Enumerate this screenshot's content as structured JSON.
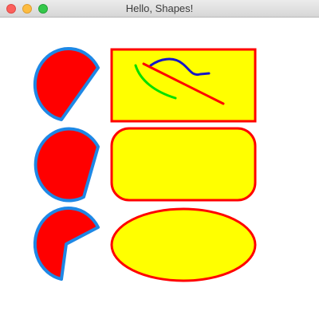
{
  "window": {
    "title": "Hello, Shapes!"
  },
  "colors": {
    "shape_fill": "#ff0000",
    "shape_outline": "#1e88e5",
    "box_fill": "#ffff00",
    "box_outline": "#ff0000",
    "line_red": "#ff0000",
    "line_blue": "#1515c8",
    "line_green": "#00e000"
  },
  "shapes": {
    "left_column": [
      "arc-shape-1",
      "arc-shape-2",
      "arc-shape-3"
    ],
    "right_column": [
      "rectangle-shape",
      "rounded-rectangle-shape",
      "ellipse-shape"
    ],
    "lines": [
      "red-line",
      "blue-curve",
      "green-curve"
    ]
  }
}
